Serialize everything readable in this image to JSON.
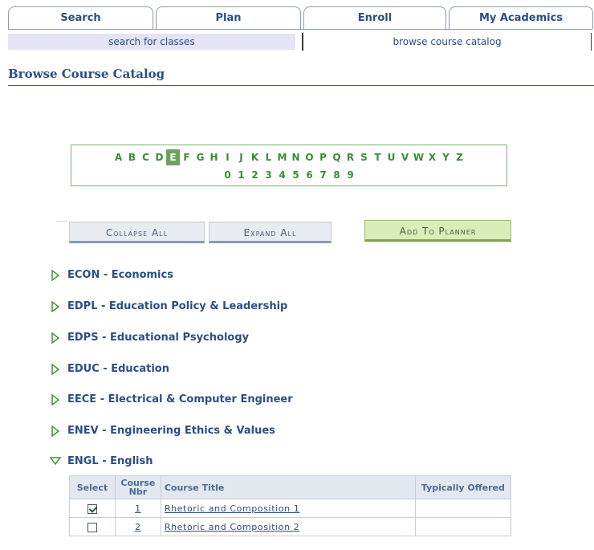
{
  "tabs": [
    {
      "label": "Search",
      "active": true
    },
    {
      "label": "Plan",
      "active": false
    },
    {
      "label": "Enroll",
      "active": false
    },
    {
      "label": "My Academics",
      "active": false
    }
  ],
  "subnav": [
    {
      "label": "search for classes",
      "active": true
    },
    {
      "label": "browse course catalog",
      "active": false
    }
  ],
  "page_title": "Browse Course Catalog",
  "alphabet": {
    "letters": [
      "A",
      "B",
      "C",
      "D",
      "E",
      "F",
      "G",
      "H",
      "I",
      "J",
      "K",
      "L",
      "M",
      "N",
      "O",
      "P",
      "Q",
      "R",
      "S",
      "T",
      "U",
      "V",
      "W",
      "X",
      "Y",
      "Z"
    ],
    "digits": [
      "0",
      "1",
      "2",
      "3",
      "4",
      "5",
      "6",
      "7",
      "8",
      "9"
    ],
    "selected": "E"
  },
  "buttons": {
    "collapse_all": "Collapse All",
    "expand_all": "Expand All",
    "add_to_planner": "Add To Planner"
  },
  "subjects": [
    {
      "label": "ECON - Economics",
      "expanded": false
    },
    {
      "label": "EDPL - Education Policy & Leadership",
      "expanded": false
    },
    {
      "label": "EDPS - Educational Psychology",
      "expanded": false
    },
    {
      "label": "EDUC - Education",
      "expanded": false
    },
    {
      "label": "EECE - Electrical & Computer Engineer",
      "expanded": false
    },
    {
      "label": "ENEV - Engineering Ethics & Values",
      "expanded": false
    },
    {
      "label": "ENGL - English",
      "expanded": true
    }
  ],
  "course_table": {
    "headers": {
      "select": "Select",
      "course_nbr": "Course Nbr",
      "course_title": "Course Title",
      "typically_offered": "Typically Offered"
    },
    "rows": [
      {
        "checked": true,
        "nbr": "1",
        "title": "Rhetoric and Composition 1",
        "offered": ""
      },
      {
        "checked": false,
        "nbr": "2",
        "title": "Rhetoric and Composition 2",
        "offered": ""
      }
    ]
  },
  "colors": {
    "nav_text": "#2b4e86",
    "alpha_green": "#3d8a3a",
    "selected_letter_bg": "#6aa35f",
    "add_button_bg": "#d9ecba"
  }
}
